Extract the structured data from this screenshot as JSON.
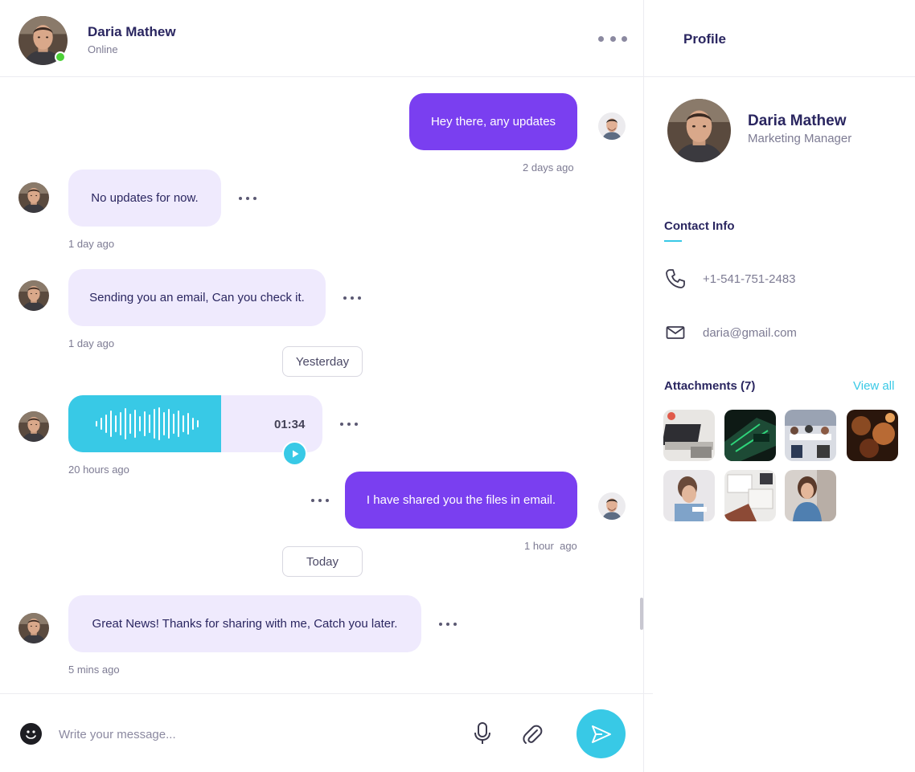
{
  "chat_header": {
    "name": "Daria Mathew",
    "status": "Online"
  },
  "messages": [
    {
      "direction": "out",
      "text": "Hey there, any updates",
      "time": "2 days ago"
    },
    {
      "direction": "in",
      "text": "No updates for now.",
      "time": "1 day ago"
    },
    {
      "direction": "in",
      "text": "Sending you an email, Can you check it.",
      "time": "1 day ago"
    },
    {
      "direction": "in",
      "type": "voice",
      "duration": "01:34",
      "time": "20 hours ago"
    },
    {
      "direction": "out",
      "text": "I have shared you the files in email.",
      "time": "1 hour  ago"
    },
    {
      "direction": "in",
      "text": "Great News! Thanks for sharing with me, Catch you later.",
      "time": "5 mins ago"
    }
  ],
  "separators": {
    "yesterday": "Yesterday",
    "today": "Today"
  },
  "composer": {
    "placeholder": "Write your message..."
  },
  "profile": {
    "title": "Profile",
    "name": "Daria Mathew",
    "role": "Marketing Manager",
    "contact_title": "Contact Info",
    "phone": "+1-541-751-2483",
    "email": "daria@gmail.com",
    "attachments_title": "Attachments (7)",
    "view_all": "View all"
  },
  "attachments": [
    "laptop-desk-photo",
    "green-code-screen-photo",
    "meeting-room-photo",
    "people-at-event-photo",
    "woman-writing-photo",
    "documents-on-desk-photo",
    "woman-portrait-photo"
  ],
  "colors": {
    "accent_purple": "#7a3ff0",
    "accent_cyan": "#38c9e6",
    "incoming_bubble": "#efeafd",
    "online": "#4cd137",
    "text_dark": "#2a2660",
    "text_muted": "#7d7b93"
  }
}
